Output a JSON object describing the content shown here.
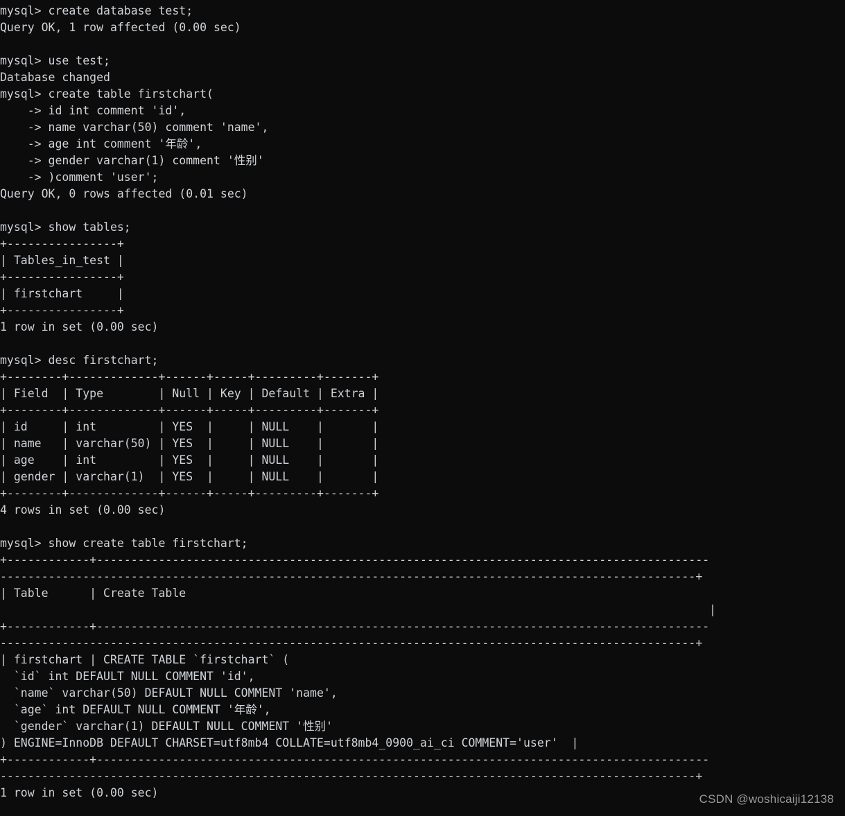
{
  "terminal": {
    "app": "mysql-client",
    "prompt": "mysql> ",
    "continuation": "    -> ",
    "colors": {
      "background": "#0c0c0c",
      "foreground": "#cfd3d8",
      "watermark": "#9a9a9a"
    },
    "font_size_px": 16.5,
    "line_height_px": 24,
    "columns": 105,
    "lines": [
      "mysql> create database test;",
      "Query OK, 1 row affected (0.00 sec)",
      "",
      "mysql> use test;",
      "Database changed",
      "mysql> create table firstchart(",
      "    -> id int comment 'id',",
      "    -> name varchar(50) comment 'name',",
      "    -> age int comment '年龄',",
      "    -> gender varchar(1) comment '性别'",
      "    -> )comment 'user';",
      "Query OK, 0 rows affected (0.01 sec)",
      "",
      "mysql> show tables;",
      "+----------------+",
      "| Tables_in_test |",
      "+----------------+",
      "| firstchart     |",
      "+----------------+",
      "1 row in set (0.00 sec)",
      "",
      "mysql> desc firstchart;",
      "+--------+-------------+------+-----+---------+-------+",
      "| Field  | Type        | Null | Key | Default | Extra |",
      "+--------+-------------+------+-----+---------+-------+",
      "| id     | int         | YES  |     | NULL    |       |",
      "| name   | varchar(50) | YES  |     | NULL    |       |",
      "| age    | int         | YES  |     | NULL    |       |",
      "| gender | varchar(1)  | YES  |     | NULL    |       |",
      "+--------+-------------+------+-----+---------+-------+",
      "4 rows in set (0.00 sec)",
      "",
      "mysql> show create table firstchart;",
      "+------------+-----------------------------------------------------------------------------------------",
      "-----------------------------------------------------------------------------------------------------+",
      "| Table      | Create Table",
      "                                                                                                       |",
      "+------------+-----------------------------------------------------------------------------------------",
      "-----------------------------------------------------------------------------------------------------+",
      "| firstchart | CREATE TABLE `firstchart` (",
      "  `id` int DEFAULT NULL COMMENT 'id',",
      "  `name` varchar(50) DEFAULT NULL COMMENT 'name',",
      "  `age` int DEFAULT NULL COMMENT '年龄',",
      "  `gender` varchar(1) DEFAULT NULL COMMENT '性别'",
      ") ENGINE=InnoDB DEFAULT CHARSET=utf8mb4 COLLATE=utf8mb4_0900_ai_ci COMMENT='user'  |",
      "+------------+-----------------------------------------------------------------------------------------",
      "-----------------------------------------------------------------------------------------------------+",
      "1 row in set (0.00 sec)"
    ],
    "statements": [
      {
        "sql": "create database test;",
        "result": "Query OK, 1 row affected (0.00 sec)"
      },
      {
        "sql": "use test;",
        "result": "Database changed"
      },
      {
        "sql": "create table firstchart( ... )comment 'user';",
        "result": "Query OK, 0 rows affected (0.01 sec)"
      },
      {
        "sql": "show tables;",
        "result": "1 row in set (0.00 sec)"
      },
      {
        "sql": "desc firstchart;",
        "result": "4 rows in set (0.00 sec)"
      },
      {
        "sql": "show create table firstchart;",
        "result": "1 row in set (0.00 sec)"
      }
    ],
    "tables": {
      "show_tables": {
        "headers": [
          "Tables_in_test"
        ],
        "rows": [
          [
            "firstchart"
          ]
        ],
        "footer": "1 row in set (0.00 sec)"
      },
      "describe_firstchart": {
        "headers": [
          "Field",
          "Type",
          "Null",
          "Key",
          "Default",
          "Extra"
        ],
        "rows": [
          [
            "id",
            "int",
            "YES",
            "",
            "NULL",
            ""
          ],
          [
            "name",
            "varchar(50)",
            "YES",
            "",
            "NULL",
            ""
          ],
          [
            "age",
            "int",
            "YES",
            "",
            "NULL",
            ""
          ],
          [
            "gender",
            "varchar(1)",
            "YES",
            "",
            "NULL",
            ""
          ]
        ],
        "footer": "4 rows in set (0.00 sec)"
      },
      "show_create_table": {
        "headers": [
          "Table",
          "Create Table"
        ],
        "table_name": "firstchart",
        "ddl": [
          "CREATE TABLE `firstchart` (",
          "  `id` int DEFAULT NULL COMMENT 'id',",
          "  `name` varchar(50) DEFAULT NULL COMMENT 'name',",
          "  `age` int DEFAULT NULL COMMENT '年龄',",
          "  `gender` varchar(1) DEFAULT NULL COMMENT '性别'",
          ") ENGINE=InnoDB DEFAULT CHARSET=utf8mb4 COLLATE=utf8mb4_0900_ai_ci COMMENT='user'"
        ],
        "footer": "1 row in set (0.00 sec)"
      }
    }
  },
  "watermark": {
    "text": "CSDN @woshicaiji12138"
  }
}
